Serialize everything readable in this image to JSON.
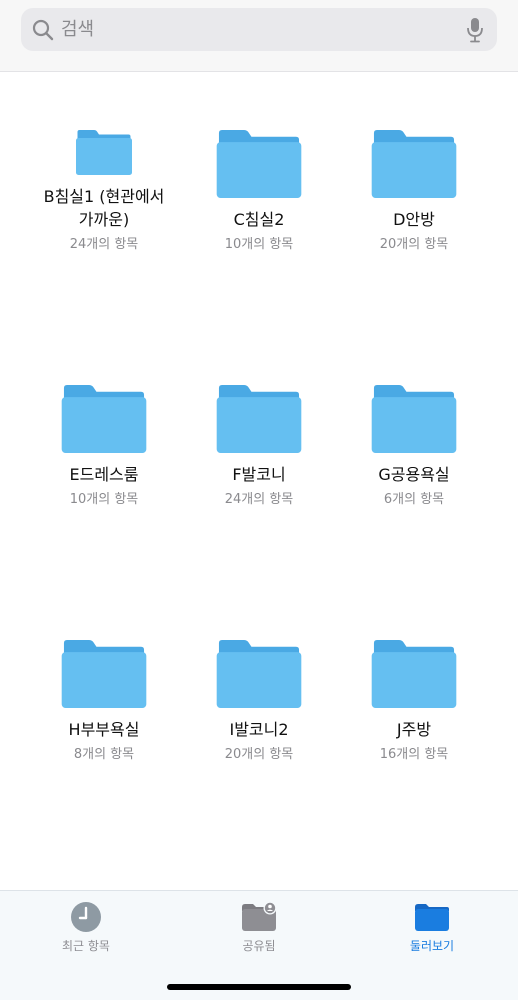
{
  "search": {
    "placeholder": "검색"
  },
  "colors": {
    "folder_front": "#65bff1",
    "folder_back": "#4aa9e4",
    "accent": "#1a7de0"
  },
  "folders": [
    {
      "name": "B침실1 (현관에서 가까운)",
      "count": "24개의 항목"
    },
    {
      "name": "C침실2",
      "count": "10개의 항목"
    },
    {
      "name": "D안방",
      "count": "20개의 항목"
    },
    {
      "name": "E드레스룸",
      "count": "10개의 항목"
    },
    {
      "name": "F발코니",
      "count": "24개의 항목"
    },
    {
      "name": "G공용욕실",
      "count": "6개의 항목"
    },
    {
      "name": "H부부욕실",
      "count": "8개의 항목"
    },
    {
      "name": "I발코니2",
      "count": "20개의 항목"
    },
    {
      "name": "J주방",
      "count": "16개의 항목"
    }
  ],
  "tabs": [
    {
      "label": "최근 항목",
      "icon": "clock-icon",
      "active": false
    },
    {
      "label": "공유됨",
      "icon": "shared-folder-icon",
      "active": false
    },
    {
      "label": "둘러보기",
      "icon": "folder-icon",
      "active": true
    }
  ]
}
